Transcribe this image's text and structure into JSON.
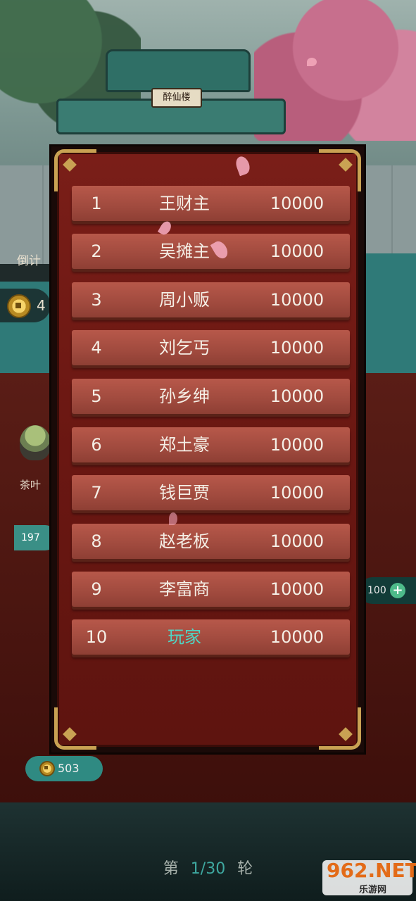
{
  "scene": {
    "signboard": "醉仙楼",
    "countdown_label": "倒计",
    "coin_count_partial": "4",
    "tea_label": "茶叶",
    "tea_price_partial": "197",
    "right_value_partial": "100",
    "money": "503"
  },
  "ranking": {
    "rows": [
      {
        "rank": "1",
        "name": "王财主",
        "score": "10000"
      },
      {
        "rank": "2",
        "name": "吴摊主",
        "score": "10000"
      },
      {
        "rank": "3",
        "name": "周小贩",
        "score": "10000"
      },
      {
        "rank": "4",
        "name": "刘乞丐",
        "score": "10000"
      },
      {
        "rank": "5",
        "name": "孙乡绅",
        "score": "10000"
      },
      {
        "rank": "6",
        "name": "郑土豪",
        "score": "10000"
      },
      {
        "rank": "7",
        "name": "钱巨贾",
        "score": "10000"
      },
      {
        "rank": "8",
        "name": "赵老板",
        "score": "10000"
      },
      {
        "rank": "9",
        "name": "李富商",
        "score": "10000"
      },
      {
        "rank": "10",
        "name": "玩家",
        "score": "10000"
      }
    ]
  },
  "round": {
    "prefix": "第",
    "current": "1/30",
    "suffix": "轮"
  },
  "watermark": {
    "brand": "962.NET",
    "sub": "乐游网"
  },
  "colors": {
    "panel_red": "#6a1712",
    "plank": "#a04a3e",
    "player_name": "#4fd6c4",
    "gold_trim": "#c9a253",
    "teal_pill": "#2f8a82"
  }
}
